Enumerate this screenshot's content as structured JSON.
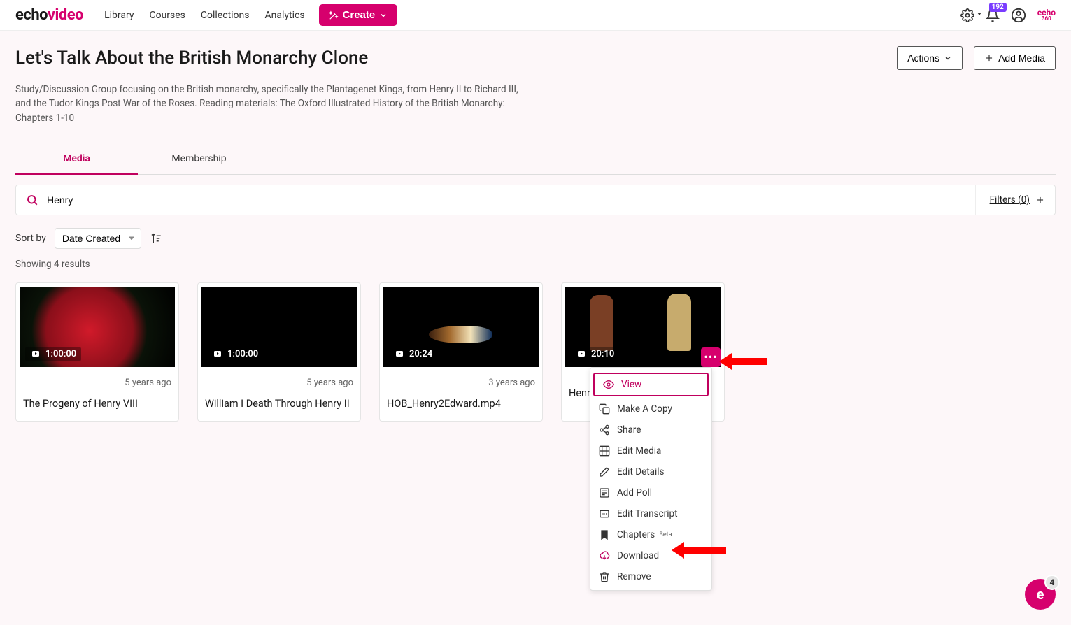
{
  "brand": {
    "part1": "echo",
    "part2": "video"
  },
  "nav": {
    "library": "Library",
    "courses": "Courses",
    "collections": "Collections",
    "analytics": "Analytics"
  },
  "create_label": "Create",
  "notification_count": "192",
  "echo360": {
    "top": "echo",
    "sub": "360"
  },
  "page_title": "Let's Talk About the British Monarchy Clone",
  "actions_label": "Actions",
  "add_media_label": "Add Media",
  "description": "Study/Discussion Group focusing on the British monarchy, specifically the Plantagenet Kings, from Henry II to Richard III, and the Tudor Kings Post War of the Roses. Reading materials: The Oxford Illustrated History of the British Monarchy: Chapters 1-10",
  "tabs": {
    "media": "Media",
    "membership": "Membership"
  },
  "search_value": "Henry",
  "filters_label": "Filters (0)",
  "sort_label": "Sort by",
  "sort_value": "Date Created",
  "results_text": "Showing 4 results",
  "cards": [
    {
      "duration": "1:00:00",
      "ago": "5 years ago",
      "title": "The Progeny of Henry VIII"
    },
    {
      "duration": "1:00:00",
      "ago": "5 years ago",
      "title": "William I Death Through Henry II"
    },
    {
      "duration": "20:24",
      "ago": "3 years ago",
      "title": "HOB_Henry2Edward.mp4"
    },
    {
      "duration": "20:10",
      "ago": "",
      "title": "Henry"
    }
  ],
  "menu": {
    "view": "View",
    "copy": "Make A Copy",
    "share": "Share",
    "edit_media": "Edit Media",
    "edit_details": "Edit Details",
    "add_poll": "Add Poll",
    "edit_transcript": "Edit Transcript",
    "chapters": "Chapters",
    "chapters_sup": "Beta",
    "download": "Download",
    "remove": "Remove"
  },
  "float_count": "4"
}
